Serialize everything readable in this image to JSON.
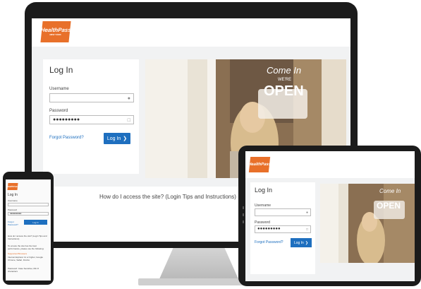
{
  "brand": {
    "logo_line1": "HealthPass",
    "logo_line2": "NEW YORK",
    "accent": "#e8702a",
    "link_color": "#1e6fbf"
  },
  "login": {
    "title": "Log In",
    "username_label": "Username",
    "password_label": "Password",
    "password_value": "●●●●●●●●●",
    "forgot_label": "Forgot Password?",
    "login_button": "Log In"
  },
  "photo": {
    "sign_line1": "Come In",
    "sign_line2": "WE'RE",
    "sign_line3": "OPEN"
  },
  "help": {
    "text": "How do I access the site? (Login Tips and Instructions)"
  },
  "phone": {
    "help_title": "How do I access the site? (Login Tips and Instructions)",
    "help_body": "To ensure the site has the best performance, please use the following:",
    "help_heading": "Supported Browsers",
    "help_detail1": "Internet Explorer 11 or higher, Google Chrome, Safari, Firefox",
    "help_detail2": "Password: Case Sensitive; Min 8 characters"
  }
}
